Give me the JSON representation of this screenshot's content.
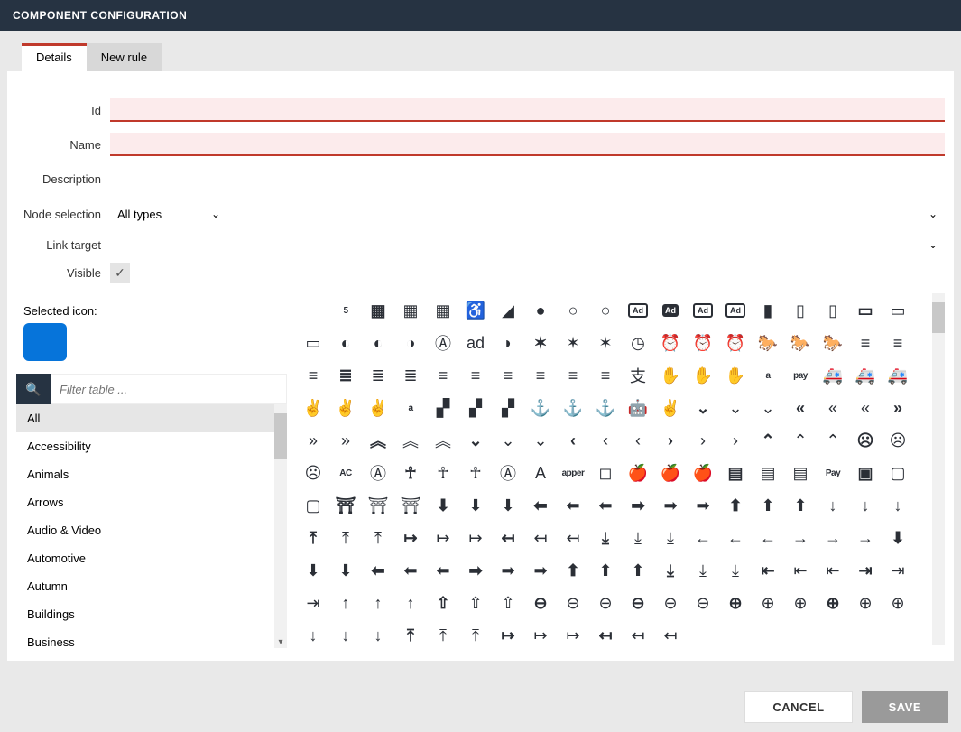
{
  "title": "COMPONENT CONFIGURATION",
  "tabs": {
    "details": "Details",
    "newrule": "New rule"
  },
  "form": {
    "id_label": "Id",
    "name_label": "Name",
    "desc_label": "Description",
    "nodesel_label": "Node selection",
    "nodesel_value": "All types",
    "linktgt_label": "Link target",
    "visible_label": "Visible"
  },
  "selected_icon_label": "Selected icon:",
  "filter_placeholder": "Filter table ...",
  "categories": [
    "All",
    "Accessibility",
    "Animals",
    "Arrows",
    "Audio & Video",
    "Automotive",
    "Autumn",
    "Buildings",
    "Business"
  ],
  "icons": [
    [
      "five-hundred-px",
      "abacus-solid",
      "abacus-regular",
      "abacus-light",
      "accessible",
      "accusoft",
      "acorn-solid",
      "acorn-regular",
      "acorn-light",
      "ad-solid",
      "ad-fill",
      "ad-regular",
      "ad-light",
      "address-book-solid",
      "address-book-regular",
      "address-book-light",
      "address-card-solid",
      "address-card-light"
    ],
    [
      "id-card",
      "adjust-solid",
      "adjust-regular",
      "adjust-light",
      "adn",
      "adversal",
      "affiliatetheme",
      "air-freshener-solid",
      "air-freshener-regular",
      "air-freshener-light",
      "clock-circle",
      "alarm-clock-solid",
      "alarm-clock-regular",
      "alarm-clock-light",
      "algolia-solid",
      "algolia-regular",
      "algolia-light",
      "align-center-solid",
      "align-center-regular"
    ],
    [
      "align-center-light",
      "align-justify-solid",
      "align-justify-regular",
      "align-justify-light",
      "align-left-solid",
      "align-left-regular",
      "align-left-light",
      "align-right-solid",
      "align-right-regular",
      "align-right-light",
      "alipay",
      "allergies-solid",
      "allergies-regular",
      "allergies-light",
      "amazon",
      "amazon-pay",
      "ambulance-solid",
      "ambulance-regular",
      "ambulance-light"
    ],
    [
      "asl-solid",
      "asl-regular",
      "asl-light",
      "amilia",
      "chart-bar-solid",
      "chart-bar-regular",
      "chart-bar-light",
      "anchor-solid",
      "anchor-regular",
      "anchor-light",
      "android",
      "peace-solid",
      "angle-double-down-solid",
      "angle-double-down-regular",
      "angle-double-down-light",
      "angle-double-left-solid",
      "angle-double-left-regular",
      "angle-double-left-light",
      "angle-double-right-solid"
    ],
    [
      "angle-double-right-regular",
      "angle-double-right-light",
      "angle-double-up-solid",
      "angle-double-up-regular",
      "angle-double-up-light",
      "angle-down-solid",
      "angle-down-regular",
      "angle-down-light",
      "angle-left-solid",
      "angle-left-regular",
      "angle-left-light",
      "angle-right-solid",
      "angle-right-regular",
      "angle-right-light",
      "angle-up-solid",
      "angle-up-regular",
      "angle-up-light",
      "angry-solid",
      "angry-regular"
    ],
    [
      "angry-light",
      "angry-creative",
      "angular",
      "ankh-solid",
      "ankh-regular",
      "ankh-light",
      "app-store",
      "app-store-ios",
      "apper",
      "apple",
      "apple-alt-solid",
      "apple-alt-regular",
      "apple-alt-light",
      "apple-crate-solid",
      "apple-crate-regular",
      "apple-crate-light",
      "apple-pay",
      "archive-solid",
      "archive-regular"
    ],
    [
      "archive-light",
      "archway-solid",
      "archway-regular",
      "archway-light",
      "arrow-circle-down-solid",
      "arrow-circle-down-regular",
      "arrow-circle-down-light",
      "arrow-circle-left-solid",
      "arrow-circle-left-regular",
      "arrow-circle-left-light",
      "arrow-circle-right-solid",
      "arrow-circle-right-regular",
      "arrow-circle-right-light",
      "arrow-circle-up-solid",
      "arrow-circle-up-regular",
      "arrow-circle-up-light",
      "arrow-down-solid",
      "arrow-down-regular",
      "arrow-down-light"
    ],
    [
      "arrow-from-bottom-solid",
      "arrow-from-bottom-regular",
      "arrow-from-bottom-light",
      "arrow-from-left-solid",
      "arrow-from-left-regular",
      "arrow-from-left-light",
      "arrow-from-right-solid",
      "arrow-from-right-regular",
      "arrow-from-right-light",
      "arrow-from-top-solid",
      "arrow-from-top-regular",
      "arrow-from-top-light",
      "arrow-left-solid",
      "arrow-left-regular",
      "arrow-left-light",
      "arrow-right-solid",
      "arrow-right-regular",
      "arrow-right-light",
      "arrow-square-down-solid"
    ],
    [
      "arrow-square-down-regular",
      "arrow-square-down-light",
      "arrow-square-left-solid",
      "arrow-square-left-regular",
      "arrow-square-left-light",
      "arrow-square-right-solid",
      "arrow-square-right-regular",
      "arrow-square-right-light",
      "arrow-square-up-solid",
      "arrow-square-up-regular",
      "arrow-square-up-light",
      "arrow-to-bottom-solid",
      "arrow-to-bottom-regular",
      "arrow-to-bottom-light",
      "arrow-to-left-solid",
      "arrow-to-left-regular",
      "arrow-to-left-light",
      "arrow-to-right-solid",
      "arrow-to-right-regular"
    ],
    [
      "arrow-to-right-light",
      "arrow-up-solid",
      "arrow-up-regular",
      "arrow-up-light",
      "arrow-alt-up-solid",
      "arrow-alt-up-regular",
      "arrow-alt-up-light",
      "arrow-alt-circle-down-solid",
      "arrow-alt-circle-down-regular",
      "arrow-alt-circle-down-light",
      "arrow-alt-circle-left-solid",
      "arrow-alt-circle-left-regular",
      "arrow-alt-circle-left-light",
      "arrow-alt-circle-right-solid",
      "arrow-alt-circle-right-regular",
      "arrow-alt-circle-right-light",
      "arrow-alt-circle-up-solid",
      "arrow-alt-circle-up-regular",
      "arrow-alt-circle-up-light"
    ],
    [
      "arrow-alt-down-solid",
      "arrow-alt-down-regular",
      "arrow-alt-down-light",
      "arrow-alt-from-bottom-solid",
      "arrow-alt-from-bottom-regular",
      "arrow-alt-from-bottom-light",
      "arrow-alt-from-left-solid",
      "arrow-alt-from-left-regular",
      "arrow-alt-from-left-light",
      "arrow-alt-from-right-solid",
      "arrow-alt-from-right-regular",
      "arrow-alt-from-right-light"
    ]
  ],
  "footer": {
    "cancel": "CANCEL",
    "save": "SAVE"
  },
  "glyph": {
    "five-hundred-px": "5",
    "abacus-solid": "▦",
    "abacus-regular": "▦",
    "abacus-light": "▦",
    "accessible": "♿",
    "accusoft": "◢",
    "acorn-solid": "●",
    "acorn-regular": "○",
    "acorn-light": "○",
    "ad-solid": "Ad",
    "ad-fill": "Ad",
    "ad-regular": "Ad",
    "ad-light": "Ad",
    "address-book-solid": "▮",
    "address-book-regular": "▯",
    "address-book-light": "▯",
    "address-card-solid": "▭",
    "address-card-light": "▭",
    "id-card": "▭",
    "adjust-solid": "◐",
    "adjust-regular": "◐",
    "adjust-light": "◑",
    "adn": "Ⓐ",
    "adversal": "ad",
    "affiliatetheme": "◗",
    "air-freshener-solid": "✶",
    "air-freshener-regular": "✶",
    "air-freshener-light": "✶",
    "clock-circle": "◷",
    "alarm-clock-solid": "⏰",
    "alarm-clock-regular": "⏰",
    "alarm-clock-light": "⏰",
    "algolia-solid": "🐎",
    "algolia-regular": "🐎",
    "algolia-light": "🐎",
    "align-center-solid": "≡",
    "align-center-regular": "≡",
    "align-center-light": "≡",
    "align-justify-solid": "≣",
    "align-justify-regular": "≣",
    "align-justify-light": "≣",
    "align-left-solid": "≡",
    "align-left-regular": "≡",
    "align-left-light": "≡",
    "align-right-solid": "≡",
    "align-right-regular": "≡",
    "align-right-light": "≡",
    "alipay": "支",
    "allergies-solid": "✋",
    "allergies-regular": "✋",
    "allergies-light": "✋",
    "amazon": "a",
    "amazon-pay": "pay",
    "ambulance-solid": "🚑",
    "ambulance-regular": "🚑",
    "ambulance-light": "🚑",
    "asl-solid": "✌",
    "asl-regular": "✌",
    "asl-light": "✌",
    "amilia": "a",
    "chart-bar-solid": "▞",
    "chart-bar-regular": "▞",
    "chart-bar-light": "▞",
    "anchor-solid": "⚓",
    "anchor-regular": "⚓",
    "anchor-light": "⚓",
    "android": "🤖",
    "peace-solid": "✌",
    "angle-double-down-solid": "⌄",
    "angle-double-down-regular": "⌄",
    "angle-double-down-light": "⌄",
    "angle-double-left-solid": "«",
    "angle-double-left-regular": "«",
    "angle-double-left-light": "«",
    "angle-double-right-solid": "»",
    "angle-double-right-regular": "»",
    "angle-double-right-light": "»",
    "angle-double-up-solid": "︽",
    "angle-double-up-regular": "︽",
    "angle-double-up-light": "︽",
    "angle-down-solid": "⌄",
    "angle-down-regular": "⌄",
    "angle-down-light": "⌄",
    "angle-left-solid": "‹",
    "angle-left-regular": "‹",
    "angle-left-light": "‹",
    "angle-right-solid": "›",
    "angle-right-regular": "›",
    "angle-right-light": "›",
    "angle-up-solid": "⌃",
    "angle-up-regular": "⌃",
    "angle-up-light": "⌃",
    "angry-solid": "☹",
    "angry-regular": "☹",
    "angry-light": "☹",
    "angry-creative": "AC",
    "angular": "Ⓐ",
    "ankh-solid": "☥",
    "ankh-regular": "☥",
    "ankh-light": "☥",
    "app-store": "Ⓐ",
    "app-store-ios": "A",
    "apper": "apper",
    "apple": "",
    "apple-alt-solid": "🍎",
    "apple-alt-regular": "🍎",
    "apple-alt-light": "🍎",
    "apple-crate-solid": "▤",
    "apple-crate-regular": "▤",
    "apple-crate-light": "▤",
    "apple-pay": "Pay",
    "archive-solid": "▣",
    "archive-regular": "▢",
    "archive-light": "▢",
    "archway-solid": "⛩",
    "archway-regular": "⛩",
    "archway-light": "⛩",
    "arrow-circle-down-solid": "⬇",
    "arrow-circle-down-regular": "⬇",
    "arrow-circle-down-light": "⬇",
    "arrow-circle-left-solid": "⬅",
    "arrow-circle-left-regular": "⬅",
    "arrow-circle-left-light": "⬅",
    "arrow-circle-right-solid": "➡",
    "arrow-circle-right-regular": "➡",
    "arrow-circle-right-light": "➡",
    "arrow-circle-up-solid": "⬆",
    "arrow-circle-up-regular": "⬆",
    "arrow-circle-up-light": "⬆",
    "arrow-down-solid": "↓",
    "arrow-down-regular": "↓",
    "arrow-down-light": "↓",
    "arrow-from-bottom-solid": "⤒",
    "arrow-from-bottom-regular": "⤒",
    "arrow-from-bottom-light": "⤒",
    "arrow-from-left-solid": "↦",
    "arrow-from-left-regular": "↦",
    "arrow-from-left-light": "↦",
    "arrow-from-right-solid": "↤",
    "arrow-from-right-regular": "↤",
    "arrow-from-right-light": "↤",
    "arrow-from-top-solid": "⤓",
    "arrow-from-top-regular": "⤓",
    "arrow-from-top-light": "⤓",
    "arrow-left-solid": "←",
    "arrow-left-regular": "←",
    "arrow-left-light": "←",
    "arrow-right-solid": "→",
    "arrow-right-regular": "→",
    "arrow-right-light": "→",
    "arrow-square-down-solid": "⬇",
    "arrow-square-down-regular": "⬇",
    "arrow-square-down-light": "⬇",
    "arrow-square-left-solid": "⬅",
    "arrow-square-left-regular": "⬅",
    "arrow-square-left-light": "⬅",
    "arrow-square-right-solid": "➡",
    "arrow-square-right-regular": "➡",
    "arrow-square-right-light": "➡",
    "arrow-square-up-solid": "⬆",
    "arrow-square-up-regular": "⬆",
    "arrow-square-up-light": "⬆",
    "arrow-to-bottom-solid": "⤓",
    "arrow-to-bottom-regular": "⤓",
    "arrow-to-bottom-light": "⤓",
    "arrow-to-left-solid": "⇤",
    "arrow-to-left-regular": "⇤",
    "arrow-to-left-light": "⇤",
    "arrow-to-right-solid": "⇥",
    "arrow-to-right-regular": "⇥",
    "arrow-to-right-light": "⇥",
    "arrow-up-solid": "↑",
    "arrow-up-regular": "↑",
    "arrow-up-light": "↑",
    "arrow-alt-up-solid": "⇧",
    "arrow-alt-up-regular": "⇧",
    "arrow-alt-up-light": "⇧",
    "arrow-alt-circle-down-solid": "⊖",
    "arrow-alt-circle-down-regular": "⊖",
    "arrow-alt-circle-down-light": "⊖",
    "arrow-alt-circle-left-solid": "⊖",
    "arrow-alt-circle-left-regular": "⊖",
    "arrow-alt-circle-left-light": "⊖",
    "arrow-alt-circle-right-solid": "⊕",
    "arrow-alt-circle-right-regular": "⊕",
    "arrow-alt-circle-right-light": "⊕",
    "arrow-alt-circle-up-solid": "⊕",
    "arrow-alt-circle-up-regular": "⊕",
    "arrow-alt-circle-up-light": "⊕",
    "arrow-alt-down-solid": "↓",
    "arrow-alt-down-regular": "↓",
    "arrow-alt-down-light": "↓",
    "arrow-alt-from-bottom-solid": "⤒",
    "arrow-alt-from-bottom-regular": "⤒",
    "arrow-alt-from-bottom-light": "⤒",
    "arrow-alt-from-left-solid": "↦",
    "arrow-alt-from-left-regular": "↦",
    "arrow-alt-from-left-light": "↦",
    "arrow-alt-from-right-solid": "↤",
    "arrow-alt-from-right-regular": "↤",
    "arrow-alt-from-right-light": "↤"
  }
}
